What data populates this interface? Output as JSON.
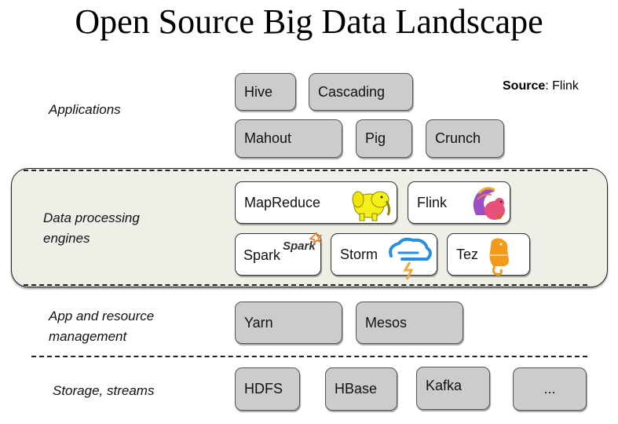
{
  "title": "Open Source Big Data Landscape",
  "source": {
    "label": "Source",
    "value": ": Flink"
  },
  "layers": {
    "applications": {
      "label": "Applications",
      "items": [
        "Hive",
        "Cascading",
        "Mahout",
        "Pig",
        "Crunch"
      ]
    },
    "engines": {
      "label_line1": "Data processing",
      "label_line2": "engines",
      "items": [
        "MapReduce",
        "Flink",
        "Spark",
        "Storm",
        "Tez"
      ],
      "icons": [
        "hadoop-elephant-icon",
        "flink-squirrel-icon",
        "spark-logo-icon",
        "storm-cloud-icon",
        "tez-elephant-icon"
      ]
    },
    "resource": {
      "label_line1": "App and resource",
      "label_line2": "management",
      "items": [
        "Yarn",
        "Mesos"
      ]
    },
    "storage": {
      "label": "Storage, streams",
      "items": [
        "HDFS",
        "HBase",
        "Kafka",
        "..."
      ]
    }
  },
  "colors": {
    "app_box": "#cccccc",
    "engine_box": "#ffffff",
    "engine_panel": "#efefe8",
    "footer_text": "#5b7bd5"
  }
}
